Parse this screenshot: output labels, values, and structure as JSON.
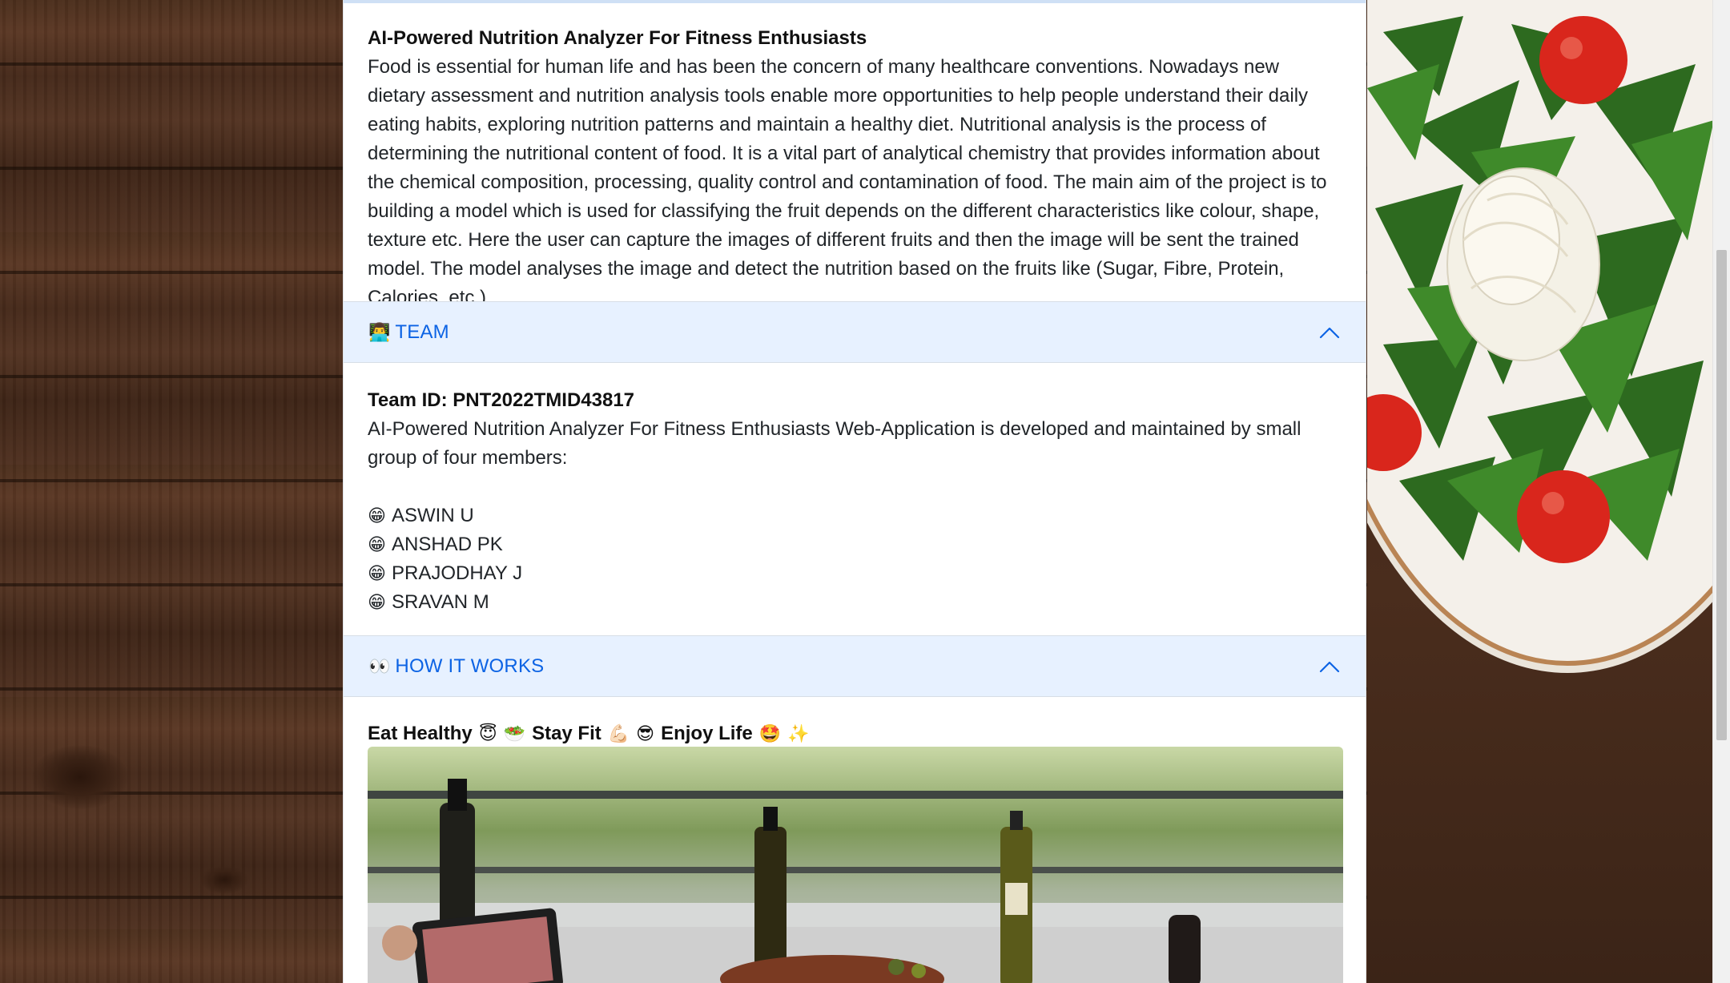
{
  "about": {
    "title": "AI-Powered Nutrition Analyzer For Fitness Enthusiasts",
    "description": "Food is essential for human life and has been the concern of many healthcare conventions. Nowadays new dietary assessment and nutrition analysis tools enable more opportunities to help people understand their daily eating habits, exploring nutrition patterns and maintain a healthy diet. Nutritional analysis is the process of determining the nutritional content of food. It is a vital part of analytical chemistry that provides information about the chemical composition, processing, quality control and contamination of food. The main aim of the project is to building a model which is used for classifying the fruit depends on the different characteristics like colour, shape, texture etc. Here the user can capture the images of different fruits and then the image will be sent the trained model. The model analyses the image and detect the nutrition based on the fruits like (Sugar, Fibre, Protein, Calories, etc.)."
  },
  "team": {
    "header_icon": "👨‍💻",
    "header_label": "TEAM",
    "team_id": "Team ID: PNT2022TMID43817",
    "intro": "AI-Powered Nutrition Analyzer For Fitness Enthusiasts Web-Application is developed and maintained by small group of four members:",
    "member_icon": "😁",
    "members": [
      "ASWIN U",
      "ANSHAD PK",
      "PRAJODHAY J",
      "SRAVAN M"
    ]
  },
  "how_it_works": {
    "header_icon": "👀",
    "header_label": "HOW IT WORKS",
    "tagline": {
      "part1": "Eat Healthy",
      "emoji1": "😇",
      "emoji2": "🥗",
      "part2": "Stay Fit",
      "emoji3": "💪🏻",
      "emoji4": "😎",
      "part3": "Enjoy Life",
      "emoji5": "🤩",
      "emoji6": "✨"
    }
  },
  "colors": {
    "accordion_header_bg": "#e7f1ff",
    "accordion_header_text": "#0c63e4",
    "card_bg": "#ffffff"
  }
}
